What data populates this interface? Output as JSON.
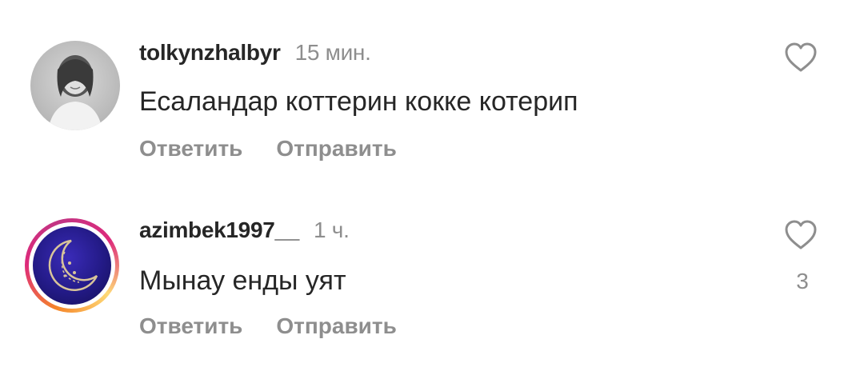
{
  "comments": [
    {
      "username": "tolkynzhalbyr",
      "time": "15 мин.",
      "text": "Есаландар коттерин кокке котерип",
      "reply_label": "Ответить",
      "send_label": "Отправить",
      "like_count": ""
    },
    {
      "username": "azimbek1997__",
      "time": "1 ч.",
      "text": "Мынау енды уят",
      "reply_label": "Ответить",
      "send_label": "Отправить",
      "like_count": "3"
    }
  ],
  "icons": {
    "like": "heart-outline-icon"
  },
  "colors": {
    "text": "#262626",
    "muted": "#8e8e8e",
    "story_ring": "#dd2a7b"
  }
}
